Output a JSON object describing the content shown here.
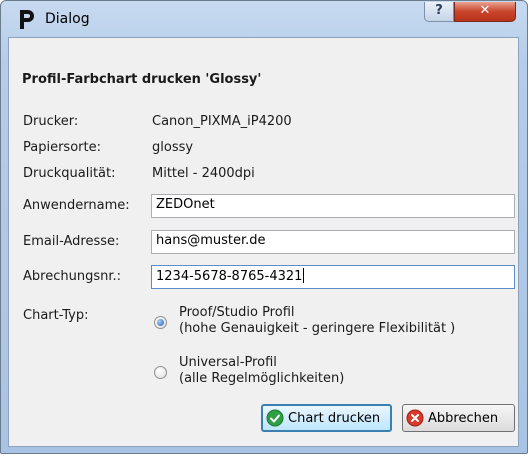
{
  "window": {
    "title": "Dialog"
  },
  "heading": "Profil-Farbchart drucken 'Glossy'",
  "info": [
    {
      "label": "Drucker:",
      "value": "Canon_PIXMA_iP4200"
    },
    {
      "label": "Papiersorte:",
      "value": "glossy"
    },
    {
      "label": "Druckqualität:",
      "value": "Mittel - 2400dpi"
    }
  ],
  "fields": {
    "username": {
      "label": "Anwendername:",
      "value": "ZEDOnet"
    },
    "email": {
      "label": "Email-Adresse:",
      "value": "hans@muster.de"
    },
    "billing": {
      "label": "Abrechungsnr.:",
      "value": "1234-5678-8765-4321"
    }
  },
  "chart_type": {
    "label": "Chart-Typ:",
    "options": [
      {
        "line1": "Proof/Studio Profil",
        "line2": "(hohe Genauigkeit - geringere Flexibilität )",
        "checked": true
      },
      {
        "line1": "Universal-Profil",
        "line2": "(alle Regelmöglichkeiten)",
        "checked": false
      }
    ]
  },
  "buttons": {
    "print": "Chart drucken",
    "cancel": "Abbrechen"
  },
  "titlebar": {
    "help": "?",
    "close": "✕"
  },
  "icons": {
    "app": "p-logo-icon",
    "print": "check-icon",
    "cancel": "cancel-x-icon"
  },
  "colors": {
    "accent": "#3c7fb1",
    "close": "#c9452b",
    "ok_icon": "#2ea043",
    "cancel_icon": "#d93a2b"
  }
}
